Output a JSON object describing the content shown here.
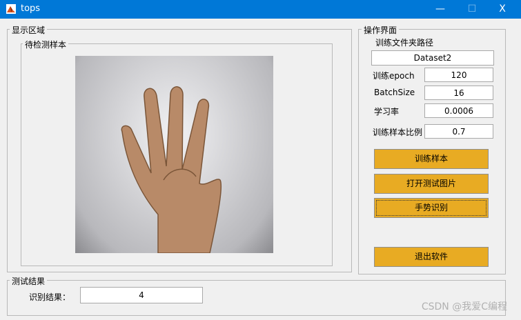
{
  "window": {
    "title": "tops",
    "minimize": "—",
    "maximize": "☐",
    "close": "X"
  },
  "display_panel": {
    "title": "显示区域",
    "sample_panel_title": "待检测样本"
  },
  "control_panel": {
    "title": "操作界面",
    "path_label": "训练文件夹路径",
    "path_value": "Dataset2",
    "params": [
      {
        "label": "训练epoch",
        "value": "120"
      },
      {
        "label": "BatchSize",
        "value": "16"
      },
      {
        "label": "学习率",
        "value": "0.0006"
      },
      {
        "label": "训练样本比例",
        "value": "0.7"
      }
    ],
    "buttons": {
      "train": "训练样本",
      "open": "打开测试图片",
      "recognize": "手势识别",
      "exit": "退出软件"
    }
  },
  "result_panel": {
    "title": "测试结果",
    "label": "识别结果：",
    "value": "4"
  },
  "watermark": "CSDN @我爱C编程",
  "colors": {
    "titlebar": "#0078d7",
    "button": "#e8ab23"
  }
}
